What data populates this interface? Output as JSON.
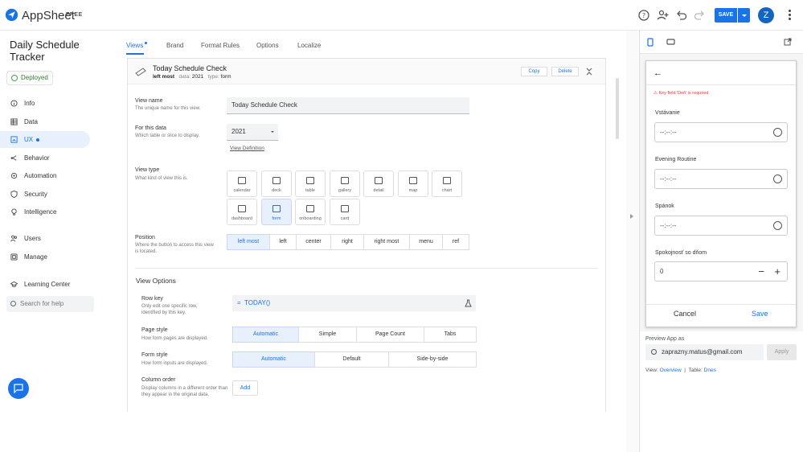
{
  "header": {
    "brand": "AppSheet",
    "plan_badge": "FREE",
    "save_label": "SAVE",
    "avatar_initial": "Z",
    "accent_color": "#1a73e8"
  },
  "sidebar": {
    "app_title": "Daily Schedule Tracker",
    "status": "Deployed",
    "items": [
      {
        "label": "Info",
        "icon": "info-icon"
      },
      {
        "label": "Data",
        "icon": "data-icon"
      },
      {
        "label": "UX",
        "icon": "ux-icon"
      },
      {
        "label": "Behavior",
        "icon": "behavior-icon"
      },
      {
        "label": "Automation",
        "icon": "automation-icon"
      },
      {
        "label": "Security",
        "icon": "security-icon"
      },
      {
        "label": "Intelligence",
        "icon": "intelligence-icon"
      },
      {
        "label": "Users",
        "icon": "users-icon"
      },
      {
        "label": "Manage",
        "icon": "manage-icon"
      },
      {
        "label": "Learning Center",
        "icon": "learning-icon"
      }
    ],
    "search_placeholder": "Search for help"
  },
  "tabs": [
    "Views",
    "Brand",
    "Format Rules",
    "Options",
    "Localize"
  ],
  "view": {
    "title": "Today Schedule Check",
    "position": "left most",
    "data_label": "data:",
    "data_value": "2021",
    "type_label": "type:",
    "type_value": "form",
    "copy_label": "Copy",
    "delete_label": "Delete"
  },
  "form": {
    "view_name_label": "View name",
    "view_name_desc": "The unique name for this view.",
    "view_name_value": "Today Schedule Check",
    "data_label": "For this data",
    "data_desc": "Which table or slice to display.",
    "data_value": "2021",
    "view_definition_link": "View Definition",
    "view_type_label": "View type",
    "view_type_desc": "What kind of view this is.",
    "view_types": [
      "calendar",
      "deck",
      "table",
      "gallery",
      "detail",
      "map",
      "chart",
      "dashboard",
      "form",
      "onboarding",
      "card"
    ],
    "position_label": "Position",
    "position_desc": "Where the button to access this view is located.",
    "positions": [
      "left most",
      "left",
      "center",
      "right",
      "right most",
      "menu",
      "ref"
    ],
    "view_options_heading": "View Options",
    "row_key_label": "Row key",
    "row_key_desc": "Only edit one specific row, identified by this key.",
    "row_key_value": "TODAY()",
    "page_style_label": "Page style",
    "page_style_desc": "How form pages are displayed.",
    "page_styles": [
      "Automatic",
      "Simple",
      "Page Count",
      "Tabs"
    ],
    "form_style_label": "Form style",
    "form_style_desc": "How form inputs are displayed.",
    "form_styles": [
      "Automatic",
      "Default",
      "Side-by-side"
    ],
    "column_order_label": "Column order",
    "column_order_desc": "Display columns in a different order than they appear in the original data.",
    "add_label": "Add"
  },
  "preview": {
    "error": "Key field 'Deň' is required",
    "fields": [
      {
        "label": "Vstávanie",
        "value": "--:--:--"
      },
      {
        "label": "Evening Routine",
        "value": "--:--:--"
      },
      {
        "label": "Spánok",
        "value": "--:--:--"
      }
    ],
    "stepper_label": "Spokojnosť so dňom",
    "stepper_value": "0",
    "cancel_label": "Cancel",
    "save_label": "Save",
    "preview_as_label": "Preview App as",
    "email": "zaprazny.matus@gmail.com",
    "apply_label": "Apply",
    "view_prefix": "View:",
    "view_link": "Overview",
    "table_prefix": "Table:",
    "table_link": "Dnes"
  }
}
